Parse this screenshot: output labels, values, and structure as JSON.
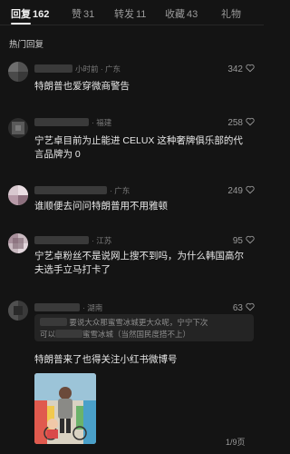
{
  "tabs": [
    {
      "label": "回复",
      "count": "162",
      "active": true
    },
    {
      "label": "赞",
      "count": "31"
    },
    {
      "label": "转发",
      "count": "11"
    },
    {
      "label": "收藏",
      "count": "43"
    },
    {
      "label": "礼物",
      "count": ""
    }
  ],
  "section_title": "热门回复",
  "comments": [
    {
      "meta": "小时前 · 广东",
      "likes": "342",
      "text": "特朗普也爱穿微商警告"
    },
    {
      "meta": "· 福建",
      "likes": "258",
      "text": "宁艺卓目前为止能进 CELUX 这种奢牌俱乐部的代言品牌为 0"
    },
    {
      "meta": "· 广东",
      "likes": "249",
      "text": "谁顺便去问问特朗普用不用雅顿"
    },
    {
      "meta": "· 江苏",
      "likes": "95",
      "text": "宁艺卓粉丝不是说网上搜不到吗，为什么韩国高尔夫选手立马打卡了"
    },
    {
      "meta": "· 湖南",
      "likes": "63",
      "text": "特朗普来了也得关注小红书微博号",
      "quote_line1": "要说大众那蜜雪冰城更大众呢，宁宁下次",
      "quote_line2_prefix": "可以",
      "quote_line2_suffix": "蜜雪冰城（当然国民度搭不上）",
      "image_count": "1/9页"
    }
  ]
}
